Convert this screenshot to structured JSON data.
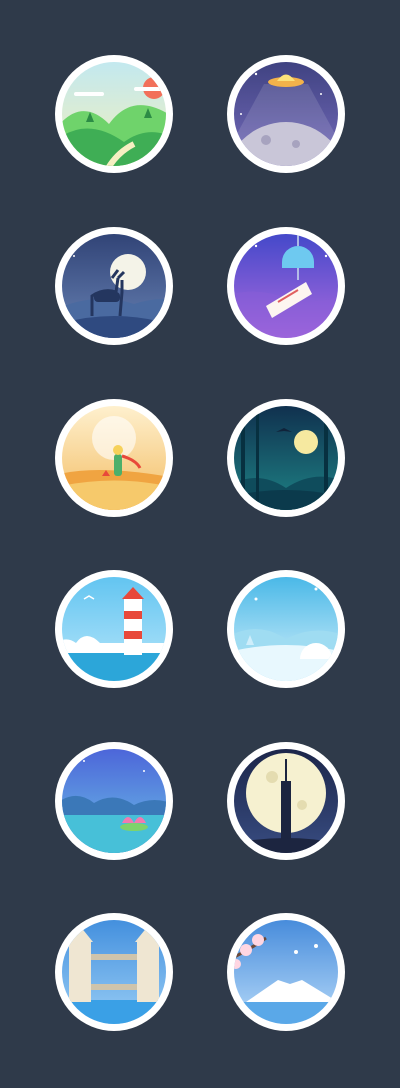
{
  "palette": {
    "background": "#2f3a4a",
    "ring": "#ffffff"
  },
  "icons": [
    {
      "name": "sunny-hills-icon",
      "top": "#bfe8f3",
      "bottom": "#f6f0b8"
    },
    {
      "name": "ufo-moon-icon",
      "top": "#3b3f7d",
      "bottom": "#7a6fc0"
    },
    {
      "name": "deer-moon-icon",
      "top": "#2d3f72",
      "bottom": "#6b86b8"
    },
    {
      "name": "wind-chime-icon",
      "top": "#3c46c8",
      "bottom": "#b46de0"
    },
    {
      "name": "desert-wanderer-icon",
      "top": "#fff4d6",
      "bottom": "#f2b85a"
    },
    {
      "name": "night-forest-icon",
      "top": "#0f2a4a",
      "bottom": "#1f8a8a"
    },
    {
      "name": "lighthouse-sea-icon",
      "top": "#5cc2f0",
      "bottom": "#bfe9fb"
    },
    {
      "name": "snowy-igloo-icon",
      "top": "#3fb4e6",
      "bottom": "#e3f6fd"
    },
    {
      "name": "lotus-pond-icon",
      "top": "#4a5fd8",
      "bottom": "#6ec8e8"
    },
    {
      "name": "tower-full-moon-icon",
      "top": "#1a2346",
      "bottom": "#3a4f85"
    },
    {
      "name": "tower-bridge-icon",
      "top": "#3d8bdc",
      "bottom": "#9fd2f7"
    },
    {
      "name": "blossom-fuji-icon",
      "top": "#3f86d9",
      "bottom": "#bfe0fb"
    }
  ]
}
